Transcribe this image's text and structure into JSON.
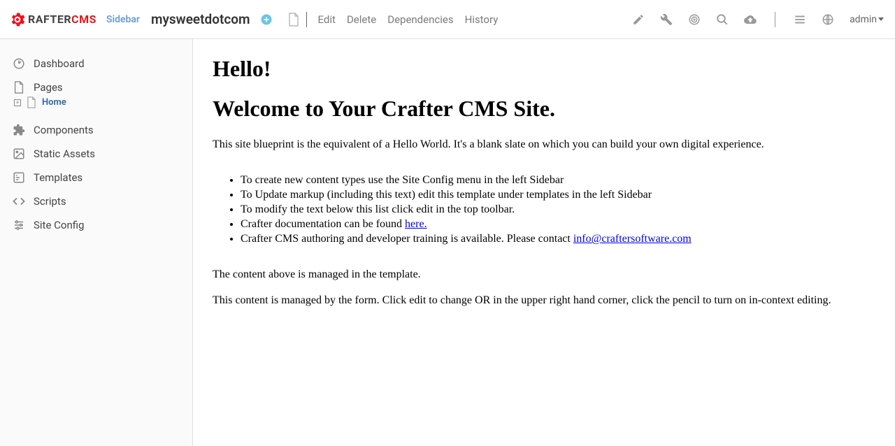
{
  "header": {
    "logo_text_1": "RAFTER",
    "logo_text_2": "CMS",
    "sidebar_label": "Sidebar",
    "site_name": "mysweetdotcom",
    "actions": {
      "edit": "Edit",
      "delete": "Delete",
      "dependencies": "Dependencies",
      "history": "History"
    },
    "user_label": "admin"
  },
  "sidebar": {
    "dashboard": "Dashboard",
    "pages": "Pages",
    "home": "Home",
    "components": "Components",
    "static_assets": "Static Assets",
    "templates": "Templates",
    "scripts": "Scripts",
    "site_config": "Site Config"
  },
  "content": {
    "h1": "Hello!",
    "h2": "Welcome to Your Crafter CMS Site.",
    "intro": "This site blueprint is the equivalent of a Hello World. It's a blank slate on which you can build your own digital experience.",
    "li1": "To create new content types use the Site Config menu in the left Sidebar",
    "li2": "To Update markup (including this text) edit this template under templates in the left Sidebar",
    "li3": "To modify the text below this list click edit in the top toolbar.",
    "li4_pre": "Crafter documentation can be found ",
    "li4_link": "here.",
    "li5_pre": "Crafter CMS authoring and developer training is available. Please contact ",
    "li5_link": "info@craftersoftware.com",
    "p2": "The content above is managed in the template.",
    "p3": "This content is managed by the form.  Click edit to change OR in the upper right hand corner, click the pencil to turn on in-context editing."
  }
}
